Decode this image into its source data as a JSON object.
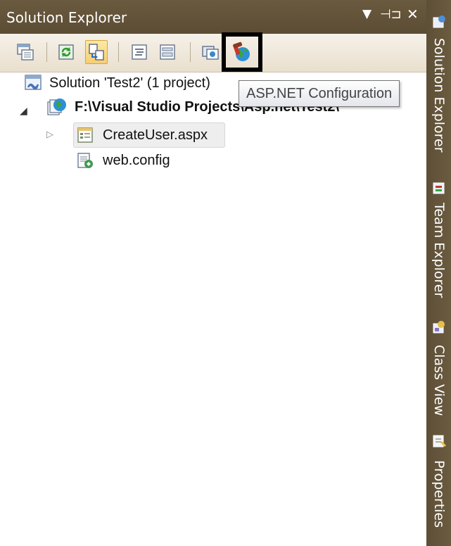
{
  "panel": {
    "title": "Solution Explorer",
    "controls": {
      "dropdown_icon": "dropdown-arrow-icon",
      "pin_icon": "pin-icon",
      "close_icon": "close-icon"
    }
  },
  "toolbar": {
    "buttons": [
      {
        "name": "properties-button",
        "icon": "properties-icon"
      },
      {
        "name": "refresh-button",
        "icon": "refresh-icon"
      },
      {
        "name": "nest-related-files-button",
        "icon": "nest-files-icon",
        "checked": true
      },
      {
        "name": "view-code-button",
        "icon": "view-code-icon"
      },
      {
        "name": "view-designer-button",
        "icon": "view-designer-icon"
      },
      {
        "name": "copy-website-button",
        "icon": "copy-website-icon"
      },
      {
        "name": "asp-net-configuration-button",
        "icon": "asp-net-configuration-icon",
        "highlighted": true
      }
    ]
  },
  "tooltip": {
    "text": "ASP.NET Configuration"
  },
  "tree": {
    "solution_label": "Solution 'Test2' (1 project)",
    "project_label": "F:\\Visual Studio Projects\\Asp.net\\Test2\\",
    "items": [
      {
        "label": "CreateUser.aspx",
        "icon": "aspx-page-icon",
        "selected": true,
        "expandable": true
      },
      {
        "label": "web.config",
        "icon": "config-file-icon",
        "selected": false,
        "expandable": false
      }
    ]
  },
  "side_tabs": [
    {
      "label": "Solution Explorer",
      "icon": "solution-explorer-icon"
    },
    {
      "label": "Team Explorer",
      "icon": "team-explorer-icon"
    },
    {
      "label": "Class View",
      "icon": "class-view-icon"
    },
    {
      "label": "Properties",
      "icon": "properties-icon"
    }
  ],
  "colors": {
    "title_bar": "#5f5039",
    "toolbar": "#efe7da",
    "tooltip_border": "#767676",
    "highlight_border": "#000000"
  }
}
